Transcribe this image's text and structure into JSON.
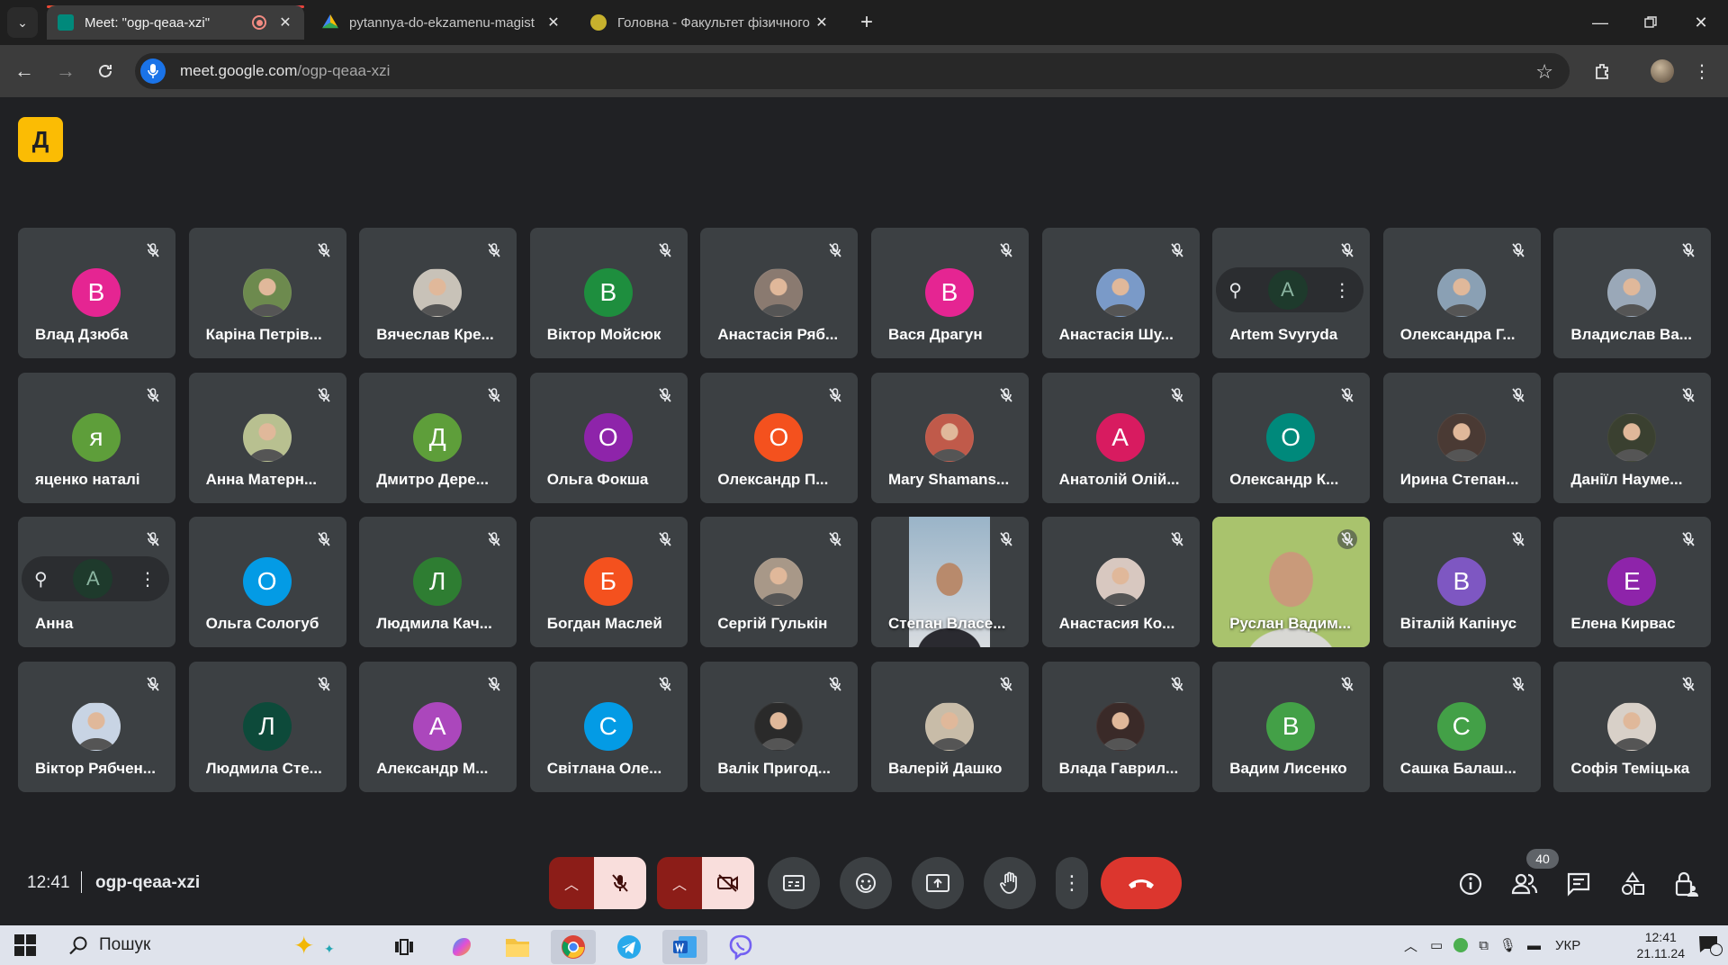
{
  "browser": {
    "tabs": [
      {
        "title": "Meet: \"ogp-qeaa-xzi\"",
        "favicon_color": "#00897b",
        "recording": true,
        "active": true
      },
      {
        "title": "pytannya-do-ekzamenu-magist",
        "favicon_color": "#fbbc04",
        "recording": false,
        "active": false
      },
      {
        "title": "Головна - Факультет фізичного",
        "favicon_color": "#c7b12d",
        "recording": false,
        "active": false
      }
    ],
    "close_glyph": "✕",
    "new_tab_glyph": "+",
    "url_host": "meet.google.com",
    "url_path": "/ogp-qeaa-xzi"
  },
  "grid": {
    "participants": [
      {
        "name": "Влад Дзюба",
        "initial": "В",
        "color": "#e52592",
        "photo": false
      },
      {
        "name": "Каріна Петрів...",
        "initial": "",
        "color": "#6d8a4e",
        "photo": true
      },
      {
        "name": "Вячеслав Кре...",
        "initial": "",
        "color": "#c8c2b8",
        "photo": true
      },
      {
        "name": "Віктор Мойсюк",
        "initial": "В",
        "color": "#1e8e3e",
        "photo": false
      },
      {
        "name": "Анастасія Ряб...",
        "initial": "",
        "color": "#8a7a70",
        "photo": true
      },
      {
        "name": "Вася Драгун",
        "initial": "В",
        "color": "#e52592",
        "photo": false
      },
      {
        "name": "Анастасія Шу...",
        "initial": "",
        "color": "#7a9ac8",
        "photo": true
      },
      {
        "name": "Artem Svyryda",
        "initial": "A",
        "color": "#1e3a2c",
        "photo": false,
        "hover": true
      },
      {
        "name": "Олександра Г...",
        "initial": "",
        "color": "#8aa0b4",
        "photo": true
      },
      {
        "name": "Владислав Ва...",
        "initial": "",
        "color": "#9aa8b8",
        "photo": true
      },
      {
        "name": "яценко наталі",
        "initial": "я",
        "color": "#5e9e3a",
        "photo": false
      },
      {
        "name": "Анна Матерн...",
        "initial": "",
        "color": "#b8c090",
        "photo": true
      },
      {
        "name": "Дмитро Дере...",
        "initial": "Д",
        "color": "#5e9e3a",
        "photo": false
      },
      {
        "name": "Ольга Фокша",
        "initial": "О",
        "color": "#8e24aa",
        "photo": false
      },
      {
        "name": "Олександр П...",
        "initial": "О",
        "color": "#f4511e",
        "photo": false
      },
      {
        "name": "Mary Shamans...",
        "initial": "",
        "color": "#c05a4a",
        "photo": true
      },
      {
        "name": "Анатолій Олій...",
        "initial": "А",
        "color": "#d81b60",
        "photo": false
      },
      {
        "name": "Олександр К...",
        "initial": "О",
        "color": "#00897b",
        "photo": false
      },
      {
        "name": "Ирина Степан...",
        "initial": "",
        "color": "#4a3a34",
        "photo": true
      },
      {
        "name": "Даніїл Науме...",
        "initial": "",
        "color": "#3a4030",
        "photo": true
      },
      {
        "name": "Анна",
        "initial": "A",
        "color": "#1e3a2c",
        "photo": false,
        "hover": true
      },
      {
        "name": "Ольга Сологуб",
        "initial": "О",
        "color": "#039be5",
        "photo": false
      },
      {
        "name": "Людмила Кач...",
        "initial": "Л",
        "color": "#2e7d32",
        "photo": false
      },
      {
        "name": "Богдан Маслей",
        "initial": "Б",
        "color": "#f4511e",
        "photo": false
      },
      {
        "name": "Сергій Гулькін",
        "initial": "",
        "color": "#a89888",
        "photo": true
      },
      {
        "name": "Степан Власе...",
        "initial": "",
        "color": "#d8dce0",
        "photo": false,
        "video": "portrait"
      },
      {
        "name": "Анастасия Ко...",
        "initial": "",
        "color": "#d8c8c0",
        "photo": true
      },
      {
        "name": "Руслан Вадим...",
        "initial": "",
        "color": "#a9c36d",
        "photo": false,
        "video": "full"
      },
      {
        "name": "Віталій Капінус",
        "initial": "В",
        "color": "#7e57c2",
        "photo": false
      },
      {
        "name": "Елена Кирвас",
        "initial": "Е",
        "color": "#8e24aa",
        "photo": false
      },
      {
        "name": "Віктор Рябчен...",
        "initial": "",
        "color": "#c8d4e4",
        "photo": true
      },
      {
        "name": "Людмила Сте...",
        "initial": "Л",
        "color": "#0d4a3a",
        "photo": false
      },
      {
        "name": "Александр М...",
        "initial": "А",
        "color": "#ab47bc",
        "photo": false
      },
      {
        "name": "Світлана Оле...",
        "initial": "С",
        "color": "#039be5",
        "photo": false
      },
      {
        "name": "Валік Пригод...",
        "initial": "",
        "color": "#2a2a2a",
        "photo": true
      },
      {
        "name": "Валерій Дашко",
        "initial": "",
        "color": "#c8bca8",
        "photo": true
      },
      {
        "name": "Влада Гаврил...",
        "initial": "",
        "color": "#3a2a28",
        "photo": true
      },
      {
        "name": "Вадим Лисенко",
        "initial": "В",
        "color": "#43a047",
        "photo": false
      },
      {
        "name": "Сашка Балаш...",
        "initial": "С",
        "color": "#43a047",
        "photo": false
      },
      {
        "name": "Софія Теміцька",
        "initial": "",
        "color": "#d8d0c8",
        "photo": true
      }
    ]
  },
  "bottom": {
    "time": "12:41",
    "meeting_code": "ogp-qeaa-xzi",
    "participant_count": "40"
  },
  "taskbar": {
    "search_label": "Пошук",
    "language": "УКР",
    "time": "12:41",
    "date": "21.11.24",
    "notification_count": "1"
  },
  "colors": {
    "hangup": "#dc362e",
    "muted_bg": "#f9dedc",
    "tile_bg": "#3c4043",
    "page_bg": "#202124"
  }
}
